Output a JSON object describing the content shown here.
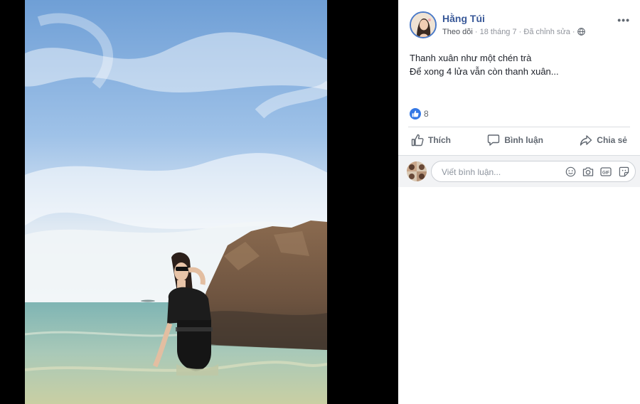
{
  "post": {
    "author": "Hằng Túi",
    "follow": "Theo dõi",
    "separator1": "·",
    "date": "18 tháng 7",
    "separator2": "·",
    "edited": "Đã chỉnh sửa",
    "separator3": "·",
    "privacy_icon": "globe-icon",
    "more": "•••",
    "caption_line1": "Thanh xuân như một chén trà",
    "caption_line2": "Để xong 4 lửa vẫn còn thanh xuân..."
  },
  "reactions": {
    "icon": "like-icon",
    "count": "8"
  },
  "actions": {
    "like": "Thích",
    "comment": "Bình luận",
    "share": "Chia sẻ"
  },
  "comment_box": {
    "placeholder": "Viết bình luận...",
    "icons": [
      "emoji-icon",
      "camera-icon",
      "gif-icon",
      "sticker-icon"
    ]
  },
  "colors": {
    "link": "#385898",
    "like_blue": "#3578e5",
    "avatar_ring": "#4a7ac9"
  }
}
